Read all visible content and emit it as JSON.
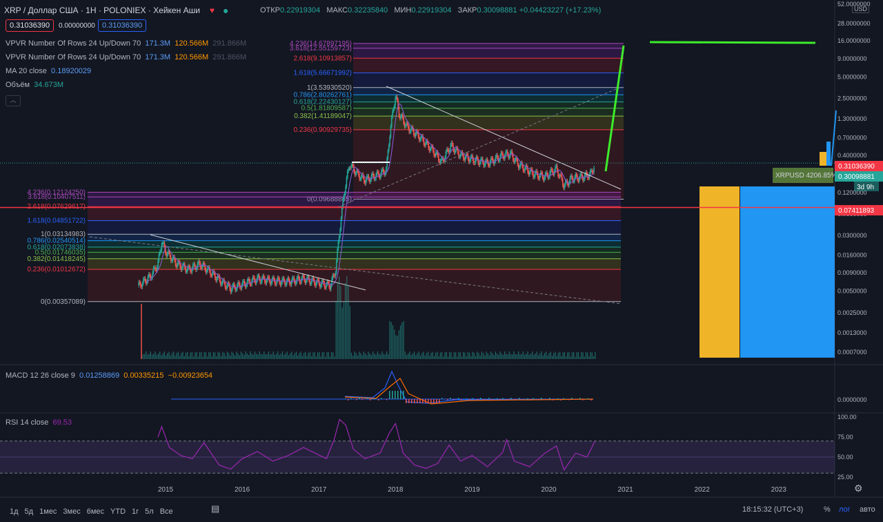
{
  "header": {
    "title": "XRP / Доллар США · 1Н · POLONIEX · Хейкен Аши",
    "ohlc": [
      {
        "label": "ОТКР",
        "value": "0.22919304"
      },
      {
        "label": "МАКС",
        "value": "0.32235840"
      },
      {
        "label": "МИН",
        "value": "0.22919304"
      },
      {
        "label": "ЗАКР",
        "value": "0.30098881"
      }
    ],
    "change": "+0.04423227 (+17.23%)",
    "sell_price": "0.31036390",
    "spread": "0.00000000",
    "buy_price": "0.31036390"
  },
  "indicators": [
    {
      "name": "VPVR Number Of Rows 24 Up/Down 70",
      "v1": "171.3M",
      "v2": "120.566M",
      "v3": "291.866M"
    },
    {
      "name": "VPVR Number Of Rows 24 Up/Down 70",
      "v1": "171.3M",
      "v2": "120.566M",
      "v3": "291.866M"
    },
    {
      "name": "MA 20 close",
      "v1": "0.18920029"
    },
    {
      "name": "Объём",
      "v1": "34.673M"
    }
  ],
  "macd": {
    "name": "MACD 12 26 close 9",
    "v1": "0.01258869",
    "v2": "0.00335215",
    "v3": "−0.00923654"
  },
  "rsi": {
    "name": "RSI 14 close",
    "v1": "69.53"
  },
  "chart_data": [
    {
      "type": "candlestick",
      "ylog": true,
      "ylim": [
        0.0006,
        60
      ],
      "y_ticks": [
        "52.0000000",
        "28.0000000",
        "16.0000000",
        "9.0000000",
        "5.0000000",
        "2.5000000",
        "1.3000000",
        "0.7000000",
        "0.4000000",
        "0.1200000",
        "0.0600000",
        "0.0300000",
        "0.0160000",
        "0.0090000",
        "0.0050000",
        "0.0025000",
        "0.0013000",
        "0.0007000"
      ],
      "y_tick_values": [
        52,
        28,
        16,
        9,
        5,
        2.5,
        1.3,
        0.7,
        0.4,
        0.12,
        0.06,
        0.03,
        0.016,
        0.009,
        0.005,
        0.0025,
        0.0013,
        0.0007
      ],
      "x_ticks": [
        "2015",
        "2016",
        "2017",
        "2018",
        "2019",
        "2020",
        "2021",
        "2022",
        "2023"
      ],
      "x_tick_years": [
        2015,
        2016,
        2017,
        2018,
        2019,
        2020,
        2021,
        2022,
        2023
      ],
      "price_path": [
        [
          2014.65,
          0.006
        ],
        [
          2014.8,
          0.008
        ],
        [
          2014.9,
          0.012
        ],
        [
          2014.95,
          0.025
        ],
        [
          2015.0,
          0.018
        ],
        [
          2015.15,
          0.012
        ],
        [
          2015.3,
          0.01
        ],
        [
          2015.45,
          0.012
        ],
        [
          2015.6,
          0.009
        ],
        [
          2015.75,
          0.0065
        ],
        [
          2015.85,
          0.0055
        ],
        [
          2016.0,
          0.0062
        ],
        [
          2016.2,
          0.0075
        ],
        [
          2016.4,
          0.007
        ],
        [
          2016.6,
          0.0068
        ],
        [
          2016.8,
          0.0075
        ],
        [
          2017.0,
          0.0065
        ],
        [
          2017.15,
          0.006
        ],
        [
          2017.22,
          0.01
        ],
        [
          2017.27,
          0.035
        ],
        [
          2017.33,
          0.12
        ],
        [
          2017.4,
          0.3
        ],
        [
          2017.5,
          0.22
        ],
        [
          2017.6,
          0.18
        ],
        [
          2017.7,
          0.2
        ],
        [
          2017.8,
          0.22
        ],
        [
          2017.88,
          0.25
        ],
        [
          2017.93,
          0.9
        ],
        [
          2018.0,
          2.8
        ],
        [
          2018.05,
          1.5
        ],
        [
          2018.15,
          1.0
        ],
        [
          2018.3,
          0.75
        ],
        [
          2018.5,
          0.45
        ],
        [
          2018.6,
          0.32
        ],
        [
          2018.72,
          0.55
        ],
        [
          2018.85,
          0.4
        ],
        [
          2019.0,
          0.35
        ],
        [
          2019.2,
          0.31
        ],
        [
          2019.4,
          0.4
        ],
        [
          2019.5,
          0.42
        ],
        [
          2019.6,
          0.3
        ],
        [
          2019.8,
          0.22
        ],
        [
          2019.95,
          0.2
        ],
        [
          2020.1,
          0.26
        ],
        [
          2020.2,
          0.15
        ],
        [
          2020.3,
          0.19
        ],
        [
          2020.45,
          0.2
        ],
        [
          2020.55,
          0.22
        ],
        [
          2020.6,
          0.3
        ]
      ],
      "fib_right": [
        {
          "label": "4.236(14.67897195)",
          "price": 14.679,
          "color": "#ab47bc"
        },
        {
          "label": "3.618(12.55159723)",
          "price": 12.552,
          "color": "#ab47bc"
        },
        {
          "label": "2.618(9.10913857)",
          "price": 9.109,
          "color": "#f23645"
        },
        {
          "label": "1.618(5.66671992)",
          "price": 5.667,
          "color": "#2962ff"
        },
        {
          "label": "1(3.53930520)",
          "price": 3.539,
          "color": "#b2b5be"
        },
        {
          "label": "0.786(2.80262761)",
          "price": 2.803,
          "color": "#2196f3"
        },
        {
          "label": "0.618(2.22430127)",
          "price": 2.224,
          "color": "#26a69a"
        },
        {
          "label": "0.5(1.81809587)",
          "price": 1.818,
          "color": "#4caf50"
        },
        {
          "label": "0.382(1.41189047)",
          "price": 1.412,
          "color": "#8bc34a"
        },
        {
          "label": "0.236(0.90929735)",
          "price": 0.909,
          "color": "#f23645"
        },
        {
          "label": "0(0.09688865)",
          "price": 0.0969,
          "color": "#b2b5be"
        }
      ],
      "fib_left": [
        {
          "label": "4.236(0.12124250)",
          "price": 0.1212,
          "color": "#ab47bc"
        },
        {
          "label": "3.618(0.10407511)",
          "price": 0.1041,
          "color": "#ab47bc"
        },
        {
          "label": "2.618(0.07629617)",
          "price": 0.0763,
          "color": "#f23645"
        },
        {
          "label": "1.618(0.04851722)",
          "price": 0.0485,
          "color": "#2962ff"
        },
        {
          "label": "1(0.03134983)",
          "price": 0.0313,
          "color": "#b2b5be"
        },
        {
          "label": "0.786(0.02540514)",
          "price": 0.0254,
          "color": "#2196f3"
        },
        {
          "label": "0.618(0.02073838)",
          "price": 0.0207,
          "color": "#26a69a"
        },
        {
          "label": "0.5(0.01746035)",
          "price": 0.0175,
          "color": "#4caf50"
        },
        {
          "label": "0.382(0.01418245)",
          "price": 0.0142,
          "color": "#8bc34a"
        },
        {
          "label": "0.236(0.01012672)",
          "price": 0.0101,
          "color": "#f23645"
        },
        {
          "label": "0(0.00357089)",
          "price": 0.00357,
          "color": "#b2b5be"
        }
      ],
      "price_labels": [
        {
          "text": "0.31036390",
          "price": 0.31036,
          "color": "#f23645"
        },
        {
          "text": "0.30098881",
          "price": 0.30099,
          "color": "#26a69a"
        },
        {
          "text": "0.07411893",
          "price": 0.07412,
          "color": "#f23645"
        }
      ],
      "countdown": "3d 9h",
      "compare_label": "XRPUSD",
      "compare_value": "4206.85%",
      "horizontal_line_price": 0.07412,
      "currency": "USD"
    },
    {
      "type": "line",
      "name": "MACD 12 26 close 9",
      "y_ticks": [
        "0.0000000"
      ]
    },
    {
      "type": "line",
      "name": "RSI 14 close",
      "ylim": [
        25,
        100
      ],
      "y_ticks": [
        "100.00",
        "75.00",
        "50.00",
        "25.00"
      ],
      "y_tick_values": [
        100,
        75,
        50,
        25
      ],
      "bands": [
        30,
        70
      ],
      "values": [
        [
          2014.9,
          75
        ],
        [
          2014.95,
          88
        ],
        [
          2015.05,
          62
        ],
        [
          2015.2,
          52
        ],
        [
          2015.35,
          48
        ],
        [
          2015.5,
          68
        ],
        [
          2015.7,
          40
        ],
        [
          2015.85,
          35
        ],
        [
          2016.0,
          48
        ],
        [
          2016.2,
          57
        ],
        [
          2016.4,
          45
        ],
        [
          2016.6,
          52
        ],
        [
          2016.8,
          62
        ],
        [
          2016.95,
          55
        ],
        [
          2017.1,
          48
        ],
        [
          2017.2,
          72
        ],
        [
          2017.27,
          97
        ],
        [
          2017.35,
          90
        ],
        [
          2017.45,
          60
        ],
        [
          2017.6,
          48
        ],
        [
          2017.8,
          55
        ],
        [
          2017.92,
          80
        ],
        [
          2018.0,
          92
        ],
        [
          2018.1,
          55
        ],
        [
          2018.25,
          40
        ],
        [
          2018.4,
          36
        ],
        [
          2018.55,
          42
        ],
        [
          2018.7,
          65
        ],
        [
          2018.85,
          45
        ],
        [
          2019.0,
          52
        ],
        [
          2019.2,
          38
        ],
        [
          2019.4,
          56
        ],
        [
          2019.45,
          72
        ],
        [
          2019.55,
          45
        ],
        [
          2019.75,
          38
        ],
        [
          2019.95,
          55
        ],
        [
          2020.1,
          64
        ],
        [
          2020.2,
          34
        ],
        [
          2020.35,
          55
        ],
        [
          2020.5,
          50
        ],
        [
          2020.6,
          69.53
        ]
      ]
    }
  ],
  "bottom_bar": {
    "ranges": [
      "1д",
      "5д",
      "1мес",
      "3мес",
      "6мес",
      "YTD",
      "1г",
      "5л",
      "Все"
    ],
    "time": "18:15:32 (UTC+3)",
    "percent": "%",
    "log": "лог",
    "auto": "авто"
  }
}
